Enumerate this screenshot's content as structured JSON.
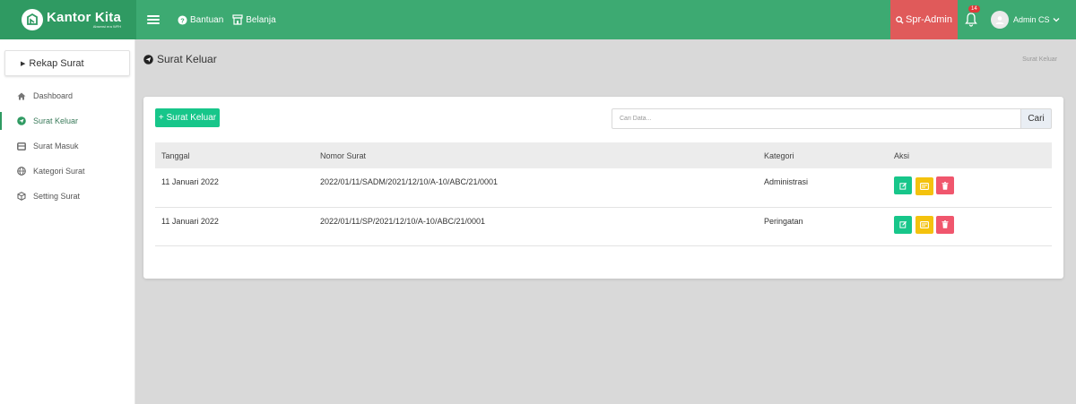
{
  "brand": {
    "title": "Kantor Kita",
    "subtitle": "Absensi era WFH"
  },
  "topbar": {
    "bantuan": "Bantuan",
    "belanja": "Belanja",
    "spr_admin": "Spr-Admin",
    "notif_count": "14",
    "user_name": "Admin CS"
  },
  "sidebar": {
    "rekap": "Rekap Surat",
    "items": [
      {
        "label": "Dashboard",
        "icon": "home-icon"
      },
      {
        "label": "Surat Keluar",
        "icon": "send-icon",
        "active": true
      },
      {
        "label": "Surat Masuk",
        "icon": "inbox-icon"
      },
      {
        "label": "Kategori Surat",
        "icon": "globe-icon"
      },
      {
        "label": "Setting Surat",
        "icon": "box-icon"
      }
    ]
  },
  "page": {
    "title": "Surat Keluar",
    "breadcrumb": "Surat Keluar"
  },
  "toolbar": {
    "add_label": "+ Surat Keluar",
    "search_placeholder": "Cari Data...",
    "search_button": "Cari"
  },
  "table": {
    "headers": [
      "Tanggal",
      "Nomor Surat",
      "Kategori",
      "Aksi"
    ],
    "rows": [
      {
        "tanggal": "11 Januari 2022",
        "nomor": "2022/01/11/SADM/2021/12/10/A-10/ABC/21/0001",
        "kategori": "Administrasi"
      },
      {
        "tanggal": "11 Januari 2022",
        "nomor": "2022/01/11/SP/2021/12/10/A-10/ABC/21/0001",
        "kategori": "Peringatan"
      }
    ]
  },
  "colors": {
    "topbar": "#3daa72",
    "brand_bg": "#2f9a62",
    "spr_admin": "#e05a5a",
    "add_button": "#17c68a",
    "edit_button": "#17c68a",
    "detail_button": "#f4c20d",
    "delete_button": "#f0566d"
  }
}
